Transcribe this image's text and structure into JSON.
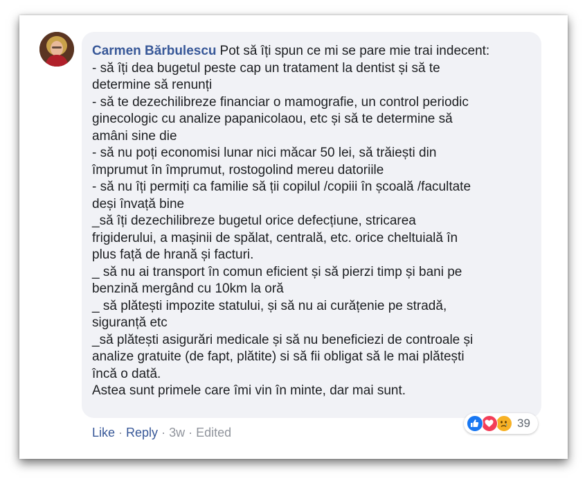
{
  "comment": {
    "author": "Carmen Bărbulescu",
    "lines": [
      "Pot să îți spun ce mi se pare mie trai indecent:",
      "- să îți dea bugetul peste cap un tratament la dentist și să te",
      "determine să renunți",
      "- să te dezechilibreze financiar o mamografie, un control periodic",
      "ginecologic cu analize papanicolaou, etc și să te determine să",
      "amâni sine die",
      "- să nu poți economisi lunar nici măcar 50 lei, să trăiești din",
      "împrumut în împrumut, rostogolind mereu datoriile",
      "- să nu îți permiți ca familie să ții copilul /copiii în școală /facultate",
      "deși învață bine",
      "_să îți dezechilibreze bugetul orice defecțiune, stricarea",
      "frigiderului, a mașinii de spălat, centrală, etc. orice cheltuială în",
      "plus față de hrană și facturi.",
      "_ să nu ai transport în comun eficient și să pierzi timp și bani pe",
      "benzină mergând cu 10km la oră",
      "_ să plătești impozite statului, și să nu ai curățenie pe stradă,",
      "siguranță etc",
      "_să plătești asigurări medicale și să nu beneficiezi de controale și",
      "analize gratuite (de fapt, plătite) si să fii obligat să le mai plătești",
      "încă o dată.",
      "Astea sunt primele care îmi vin în minte, dar mai sunt."
    ]
  },
  "actions": {
    "like": "Like",
    "reply": "Reply",
    "time": "3w",
    "edited": "Edited",
    "separator": "·"
  },
  "reactions": {
    "icons": [
      "like-icon",
      "love-icon",
      "sad-icon"
    ],
    "count": "39"
  },
  "colors": {
    "author": "#385898",
    "text": "#1c1e21",
    "meta": "#90949c",
    "bubble": "#f1f2f6",
    "like": "#1877f2",
    "love": "#f33e58",
    "sad": "#f7b125"
  }
}
